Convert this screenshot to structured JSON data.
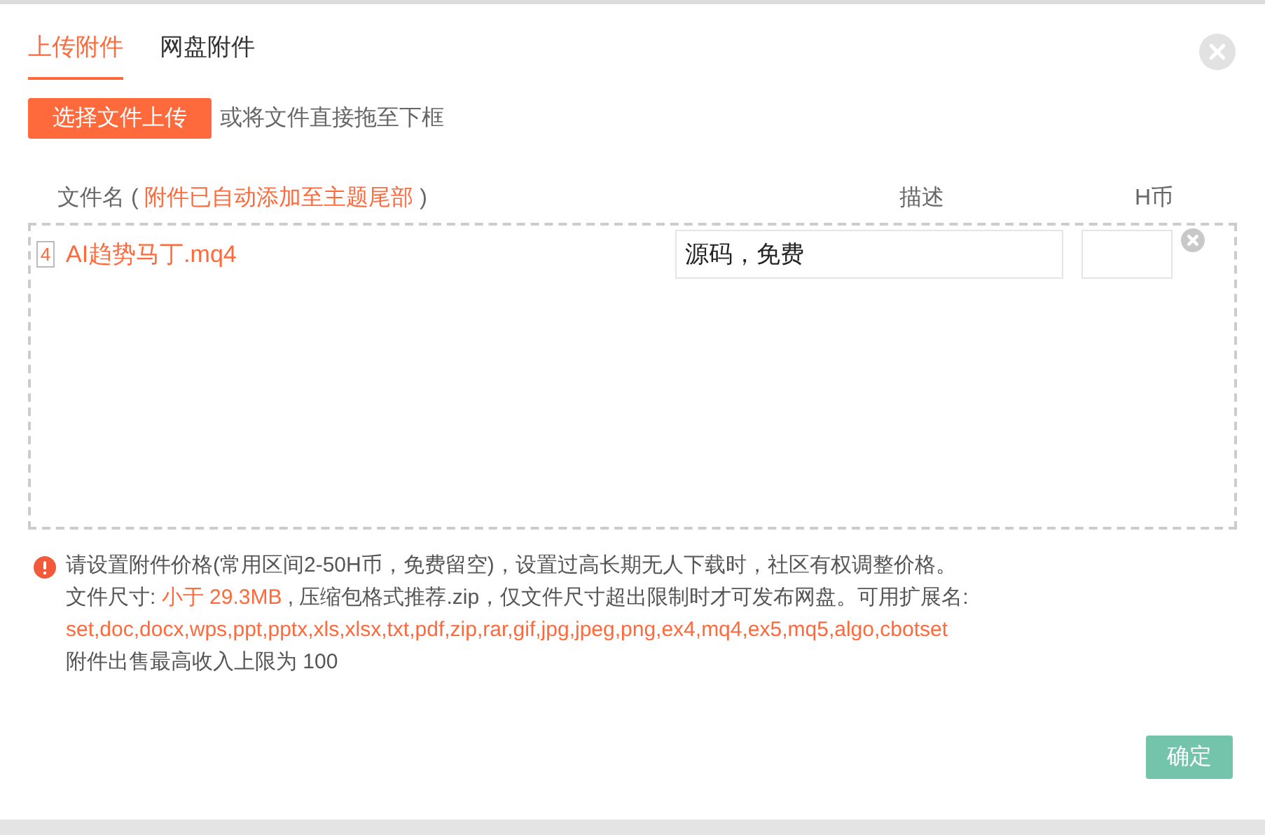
{
  "tabs": [
    {
      "label": "上传附件",
      "selected": true
    },
    {
      "label": "网盘附件",
      "selected": false
    }
  ],
  "upload_button": "选择文件上传",
  "drop_hint": "或将文件直接拖至下框",
  "columns": {
    "filename_label": "文件名 (",
    "filename_note": "附件已自动添加至主题尾部",
    "filename_close": ")",
    "description": "描述",
    "price": "H币"
  },
  "files": [
    {
      "badge": "4",
      "name": "AI趋势马丁.mq4",
      "description": "源码，免费"
    }
  ],
  "notes": {
    "warning": "请设置附件价格(常用区间2-50H币，免费留空)，设置过高长期无人下载时，社区有权调整价格。",
    "size_prefix": "文件尺寸:",
    "size_limit": "小于 29.3MB",
    "size_suffix": ", 压缩包格式推荐.zip，仅文件尺寸超出限制时才可发布网盘。可用扩展名:",
    "extensions": "set,doc,docx,wps,ppt,pptx,xls,xlsx,txt,pdf,zip,rar,gif,jpg,jpeg,png,ex4,mq4,ex5,mq5,algo,cbotset",
    "income_limit": "附件出售最高收入上限为 100"
  },
  "confirm_button": "确定"
}
